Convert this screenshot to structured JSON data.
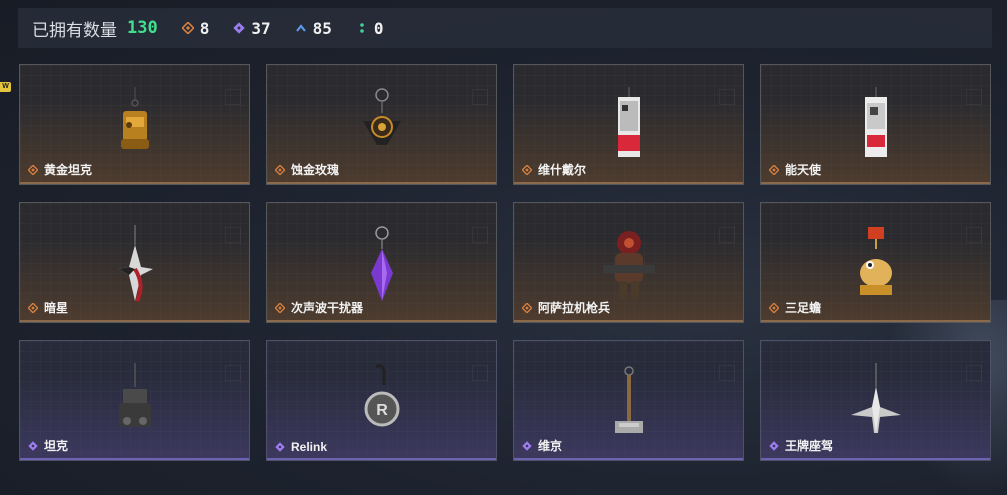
{
  "header": {
    "label": "已拥有数量",
    "count": "130",
    "stats": [
      {
        "icon": "orange-diamond-icon",
        "value": "8",
        "color": "#d9813f"
      },
      {
        "icon": "purple-diamond-icon",
        "value": "37",
        "color": "#9d7cf0"
      },
      {
        "icon": "blue-chevron-icon",
        "value": "85",
        "color": "#5a9ae6"
      },
      {
        "icon": "green-dots-icon",
        "value": "0",
        "color": "#3fd09a"
      }
    ]
  },
  "new_badge": "W",
  "items": [
    {
      "name": "黄金坦克",
      "rarity": "orange",
      "art": "golden-tank-charm"
    },
    {
      "name": "蚀金玫瑰",
      "rarity": "orange",
      "art": "rose-charm"
    },
    {
      "name": "维什戴尔",
      "rarity": "orange",
      "art": "card-charm-red"
    },
    {
      "name": "能天使",
      "rarity": "orange",
      "art": "card-charm-white"
    },
    {
      "name": "暗星",
      "rarity": "orange",
      "art": "dark-star-charm"
    },
    {
      "name": "次声波干扰器",
      "rarity": "orange",
      "art": "purple-crystal-charm"
    },
    {
      "name": "阿萨拉机枪兵",
      "rarity": "orange",
      "art": "gunner-figure-charm"
    },
    {
      "name": "三足蟾",
      "rarity": "orange",
      "art": "toad-charm"
    },
    {
      "name": "坦克",
      "rarity": "purple",
      "art": "tank-charm"
    },
    {
      "name": "Relink",
      "rarity": "purple",
      "art": "relink-charm"
    },
    {
      "name": "维京",
      "rarity": "purple",
      "art": "hammer-charm"
    },
    {
      "name": "王牌座驾",
      "rarity": "purple",
      "art": "jet-charm"
    }
  ],
  "colors": {
    "orange": "#d9813f",
    "purple": "#9d7cf0",
    "accent_green": "#3fe08f"
  }
}
